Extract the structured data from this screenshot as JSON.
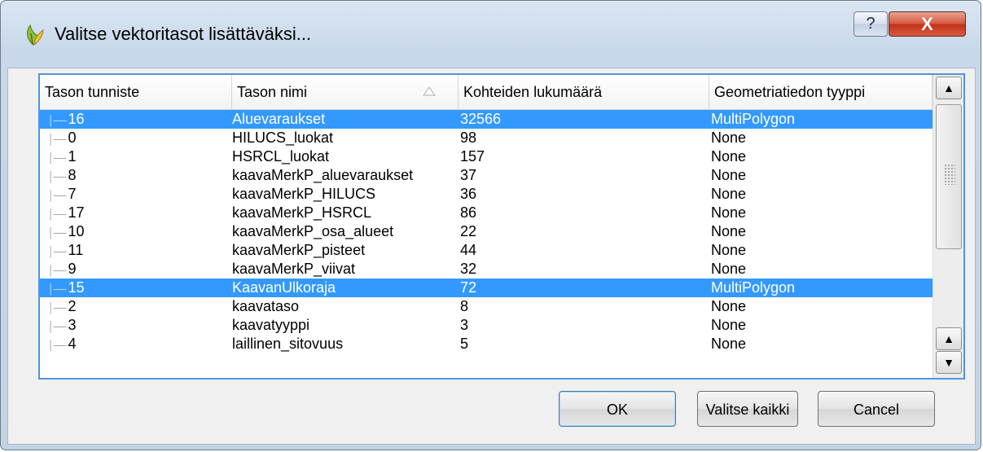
{
  "window": {
    "title": "Valitse vektoritasot lisättäväksi...",
    "help_label": "?",
    "close_label": "X"
  },
  "table": {
    "columns": [
      "Tason tunniste",
      "Tason nimi",
      "Kohteiden lukumäärä",
      "Geometriatiedon tyyppi"
    ],
    "sorted_column": "Tason nimi",
    "rows": [
      {
        "id": "16",
        "name": "Aluevaraukset",
        "count": "32566",
        "geom": "MultiPolygon",
        "selected": true
      },
      {
        "id": "0",
        "name": "HILUCS_luokat",
        "count": "98",
        "geom": "None",
        "selected": false
      },
      {
        "id": "1",
        "name": "HSRCL_luokat",
        "count": "157",
        "geom": "None",
        "selected": false
      },
      {
        "id": "8",
        "name": "kaavaMerkP_aluevaraukset",
        "count": "37",
        "geom": "None",
        "selected": false
      },
      {
        "id": "7",
        "name": "kaavaMerkP_HILUCS",
        "count": "36",
        "geom": "None",
        "selected": false
      },
      {
        "id": "17",
        "name": "kaavaMerkP_HSRCL",
        "count": "86",
        "geom": "None",
        "selected": false
      },
      {
        "id": "10",
        "name": "kaavaMerkP_osa_alueet",
        "count": "22",
        "geom": "None",
        "selected": false
      },
      {
        "id": "11",
        "name": "kaavaMerkP_pisteet",
        "count": "44",
        "geom": "None",
        "selected": false
      },
      {
        "id": "9",
        "name": "kaavaMerkP_viivat",
        "count": "32",
        "geom": "None",
        "selected": false
      },
      {
        "id": "15",
        "name": "KaavanUlkoraja",
        "count": "72",
        "geom": "MultiPolygon",
        "selected": true
      },
      {
        "id": "2",
        "name": "kaavataso",
        "count": "8",
        "geom": "None",
        "selected": false
      },
      {
        "id": "3",
        "name": "kaavatyyppi",
        "count": "3",
        "geom": "None",
        "selected": false
      },
      {
        "id": "4",
        "name": "laillinen_sitovuus",
        "count": "5",
        "geom": "None",
        "selected": false
      }
    ]
  },
  "icons": {
    "app": "qgis-icon",
    "sort": "sort-ascending-icon",
    "scroll_up": "scroll-up-arrow-icon",
    "scroll_down": "scroll-down-arrow-icon"
  },
  "buttons": {
    "ok": "OK",
    "select_all": "Valitse kaikki",
    "cancel": "Cancel"
  },
  "colors": {
    "selection": "#3399ff",
    "frame_focus": "#4f95e0",
    "close_button": "#c3301a"
  }
}
